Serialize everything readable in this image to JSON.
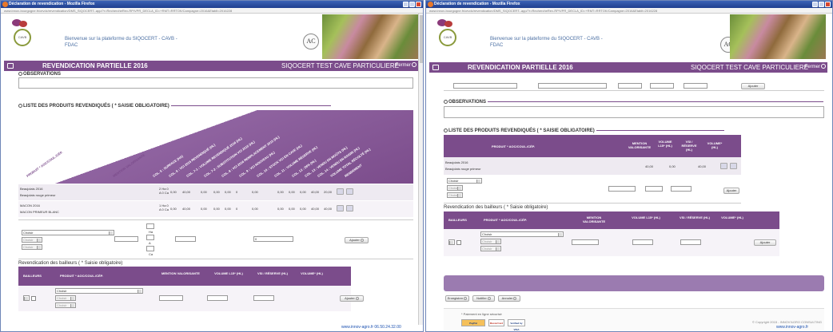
{
  "left": {
    "window_title": "Déclaration de revendication - Mozilla Firefox",
    "url": "www.innov-bourgogne.fr/cevdc/revendication/DMS_SIQOCERT-.app/?r=RechercheRev-RP/VPR_DECLA_ID=+RMT=RRTOK/Campagne=2016&Etablt=2016228",
    "welcome": [
      "Bienvenue sur la plateforme du SIQOCERT - CAVB -",
      "FDAC"
    ],
    "logo_text": "CAVB",
    "ac_logo": "AC",
    "page_title": "REVENDICATION PARTIELLE 2016",
    "operator": "SIQOCERT TEST CAVE PARTICULIERE",
    "close": "Fermer",
    "observations_label": "OBSERVATIONS",
    "list_title": "LISTE DES PRODUITS REVENDIQUÉS ( * SAISIE OBLIGATOIRE)",
    "rotated_headers": [
      "PRODUIT * AOC/COUL./CÉP.",
      "MENTION VALORISANTE",
      "COL. 5 : SURFACE (HA)",
      "COL. 6 : VCI 2015 REVENDIQUÉ (HL)",
      "COL. 7-1 : VOLUME REVENDIQUÉ 2016 (HL)",
      "COL. 7-2 : SUBSTITUTION VCI 2015 (HL)",
      "COL. 8 : VCI 2016 REMPLACEMENT 2015 (HL)",
      "COL. 9 : VCI NOUVEAU (HL)",
      "COL. 10 : STOCK VCI EN CAVE (HL)",
      "COL. 11 : VOLUME RÉSERVE (HL)",
      "COL. 12 : DPA (HL)",
      "COL. 13 : VENDU EN MOÛTS (HL)",
      "COL. 14 : VENDU EN RAISIN (HL)",
      "VOLUME TOTAL RÉCOLTÉ (HL)",
      "RENDEMENT"
    ],
    "rows": [
      {
        "name1": "Beaujolais 2016",
        "name2": "Beaujolais rouge primeur",
        "surface": "2 Ha 0\nA 0 Ca",
        "v1": "0,00",
        "v2": "40,00",
        "v3": "0,00",
        "v4": "0,00",
        "v5": "0,00",
        "v6": "0",
        "v7": "0,00",
        "v8": "0,00",
        "v9": "0,00",
        "v10": "0,00",
        "v11": "40,00",
        "v12": "20,00"
      },
      {
        "name1": "MACON 2016",
        "name2": "MACON PRIMEUR BLANC",
        "surface": "1 Ha 0\nA 0 Ca",
        "v1": "0,00",
        "v2": "40,00",
        "v3": "0,00",
        "v4": "0,00",
        "v5": "0,00",
        "v6": "0",
        "v7": "0,00",
        "v8": "0,00",
        "v9": "0,00",
        "v10": "0,00",
        "v11": "40,00",
        "v12": "40,00"
      }
    ],
    "choose": "Choisir",
    "choose_small": "Choisir",
    "unit_ha": "Ha",
    "unit_a": "A",
    "unit_ca": "Ca",
    "zero": "0",
    "add": "Ajouter",
    "bailleurs_title": "Revendication des bailleurs ( * Saisie obligatoire)",
    "b_headers": [
      "BAILLEURS",
      "PRODUIT * AOC/COUL./CÉP.",
      "MENTION VALORISANTE",
      "VOLUME L15* (HL)",
      "VSI / RÉSERVE (HL)",
      "VOLUME* (HL)"
    ],
    "status": "www.innov-agro.fr 06.50.24.32.00"
  },
  "right": {
    "window_title": "Déclaration de revendication - Mozilla Firefox",
    "url": "www.innov-bourgogne.fr/cevdc/revendication/DMS_SIQOCERT-.app/?r=RechercheRev-RP/VPR_DECLA_ID=+RMT=RRTOK/Campagne=2016&Etablt=2016228",
    "welcome": [
      "Bienvenue sur la plateforme du SIQOCERT - CAVB -",
      "FDAC"
    ],
    "logo_text": "CAVB",
    "ac_logo": "AC",
    "page_title": "REVENDICATION PARTIELLE 2016",
    "operator": "SIQOCERT TEST CAVE PARTICULIERE",
    "close": "Fermer",
    "add": "Ajouter",
    "observations_label": "OBSERVATIONS",
    "list_title": "LISTE DES PRODUITS REVENDIQUÉS ( * SAISIE OBLIGATOIRE)",
    "headers": [
      "PRODUIT * AOC/COUL./CÉP.",
      "MENTION VALORISANTE",
      "VOLUME L15* (HL)",
      "VSI / RÉSERVE (HL)",
      "VOLUME* (HL)"
    ],
    "row": {
      "name1": "Beaujolais 2016",
      "name2": "Beaujolais rouge primeur",
      "v1": "40,00",
      "v2": "0,00",
      "v3": "40,00"
    },
    "choose": "Choisir",
    "choose_small": "Choisir",
    "bailleurs_title": "Revendication des bailleurs ( * Saisie obligatoire)",
    "b_headers": [
      "BAILLEURS",
      "PRODUIT * AOC/COUL./CÉP.",
      "MENTION VALORISANTE",
      "VOLUME L15* (HL)",
      "VSI / RÉSERVE (HL)",
      "VOLUME* (HL)"
    ],
    "buttons": {
      "save": "Enregistrer",
      "notify": "Notifier",
      "cancel": "Annuler"
    },
    "payment": "* Paiement en ligne sécurisé",
    "cards": [
      "PayPal",
      "MasterCard",
      "Verified by VISA"
    ],
    "copyright": "© Copyright 2015 - INNOV'AGRO CONSULTING",
    "status": "www.innov-agro.fr"
  },
  "colors": {
    "accent": "#7b4c8b",
    "titlebar": "#2a4fa0",
    "link": "#1a50b0"
  }
}
